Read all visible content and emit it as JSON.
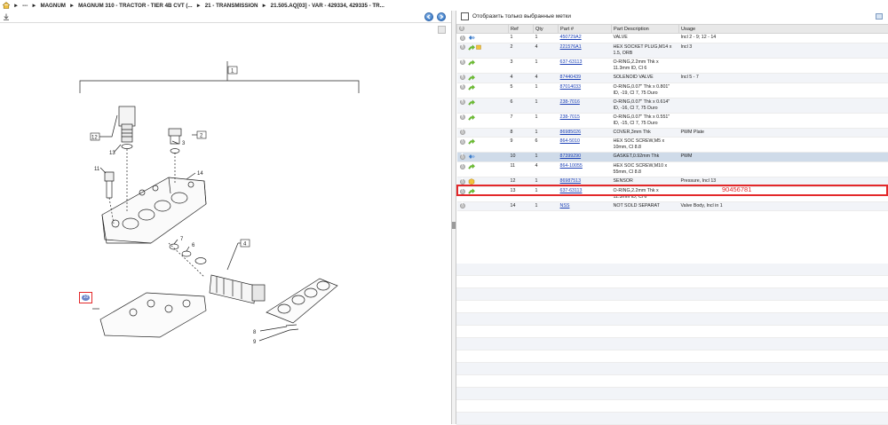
{
  "breadcrumb": {
    "items": [
      "---",
      "MAGNUM",
      "MAGNUM 310 - TRACTOR - TIER 4B CVT (...",
      "21 - TRANSMISSION",
      "21.505.AQ[03] - VAR - 429334, 429335 - TR..."
    ]
  },
  "diagram": {
    "callouts": [
      "1",
      "2",
      "3",
      "4",
      "6",
      "7",
      "8",
      "9",
      "10",
      "11",
      "12",
      "13",
      "14"
    ]
  },
  "filter": {
    "label": "Отобразить только выбранные метки"
  },
  "grid": {
    "headers": [
      "Ref",
      "Qty",
      "Part #",
      "Part Description",
      "Usage"
    ],
    "rows": [
      {
        "ref": "1",
        "qty": "1",
        "part": "450729A2",
        "desc": "VALVE",
        "desc2": "",
        "usage": "Incl 2 - 9; 12 - 14",
        "icon": "diamond"
      },
      {
        "ref": "2",
        "qty": "4",
        "part": "221576A1",
        "desc": "HEX SOCKET PLUG,M14 x",
        "desc2": "1.5, ORB",
        "usage": "Incl 3",
        "icon": "arrow-box"
      },
      {
        "ref": "3",
        "qty": "1",
        "part": "637-63113",
        "desc": "O-RING,2.2mm Thk x",
        "desc2": "11.3mm ID, Cl 6",
        "usage": "",
        "icon": "arrow"
      },
      {
        "ref": "4",
        "qty": "4",
        "part": "87440439",
        "desc": "SOLENOID VALVE",
        "desc2": "",
        "usage": "Incl 5 - 7",
        "icon": "arrow"
      },
      {
        "ref": "5",
        "qty": "1",
        "part": "87014033",
        "desc": "O-RING,0.07\" Thk x 0.801\"",
        "desc2": "ID, -19, Cl 7, 75 Duro",
        "usage": "",
        "icon": "arrow"
      },
      {
        "ref": "6",
        "qty": "1",
        "part": "238-7016",
        "desc": "O-RING,0.07\" Thk x 0.614\"",
        "desc2": "ID, -16, Cl 7, 75 Duro",
        "usage": "",
        "icon": "arrow"
      },
      {
        "ref": "7",
        "qty": "1",
        "part": "238-7015",
        "desc": "O-RING,0.07\" Thk x 0.551\"",
        "desc2": "ID, -15, Cl 7, 75 Duro",
        "usage": "",
        "icon": "arrow"
      },
      {
        "ref": "8",
        "qty": "1",
        "part": "86985026",
        "desc": "COVER,3mm Thk",
        "desc2": "",
        "usage": "PWM Plate",
        "icon": "none"
      },
      {
        "ref": "9",
        "qty": "6",
        "part": "864-5010",
        "desc": "HEX SOC SCREW,M5 x",
        "desc2": "10mm, Cl 8.8",
        "usage": "",
        "icon": "arrow"
      },
      {
        "ref": "10",
        "qty": "1",
        "part": "87399290",
        "desc": "GASKET,0.92mm Thk",
        "desc2": "",
        "usage": "PWM",
        "icon": "diamond"
      },
      {
        "ref": "11",
        "qty": "4",
        "part": "864-10055",
        "desc": "HEX SOC SCREW,M10 x",
        "desc2": "55mm, Cl 8.8",
        "usage": "",
        "icon": "arrow"
      },
      {
        "ref": "12",
        "qty": "1",
        "part": "86987513",
        "desc": "SENSOR",
        "desc2": "",
        "usage": "Pressure, Incl 13",
        "icon": "box"
      },
      {
        "ref": "13",
        "qty": "1",
        "part": "637-63113",
        "desc": "O-RING,2.2mm Thk x",
        "desc2": "11.3mm ID, Cl 6",
        "usage": "",
        "icon": "arrow"
      },
      {
        "ref": "14",
        "qty": "1",
        "part": "NSS",
        "desc": "NOT SOLD SEPARAT",
        "desc2": "",
        "usage": "Valve Body, Incl in 1",
        "icon": "none"
      }
    ],
    "selected_ref": "10",
    "annotation": "90456781"
  },
  "colors": {
    "accent_red": "#e3282a",
    "link_blue": "#1a3fb5",
    "arrow_green": "#6bbf2d"
  }
}
